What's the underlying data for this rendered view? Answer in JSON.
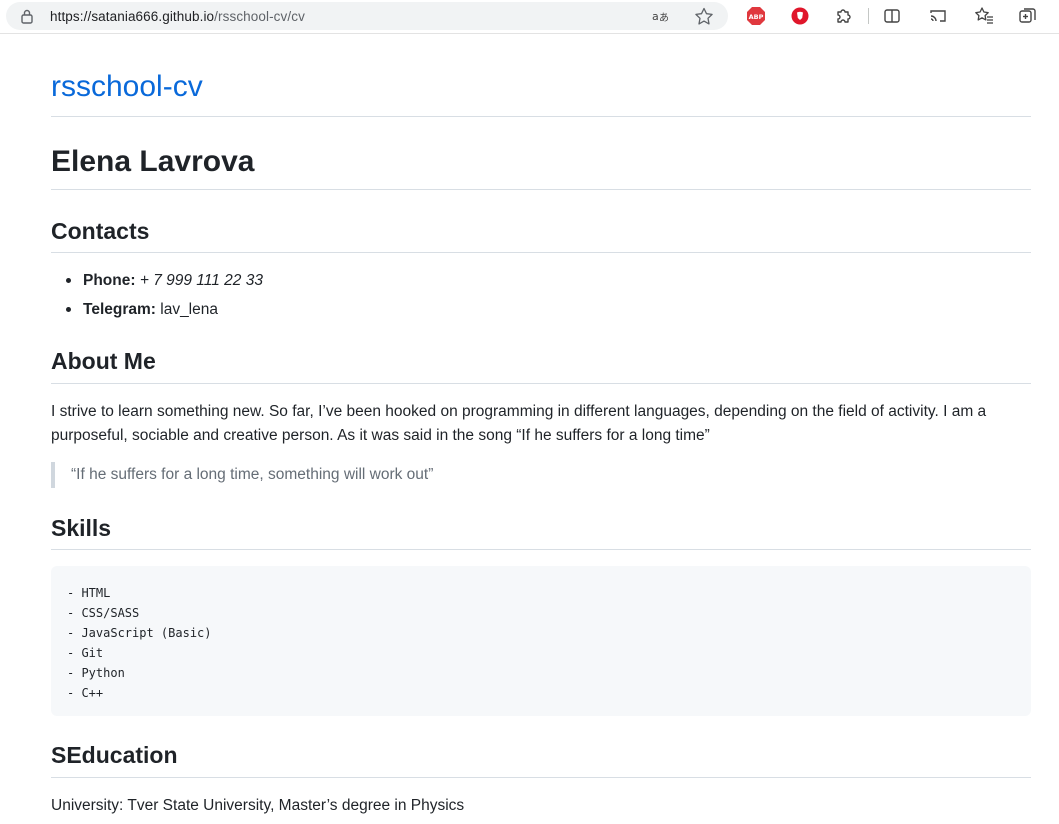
{
  "browser": {
    "url_host": "https://satania666.github.io",
    "url_path": "/rsschool-cv/cv",
    "icons": [
      "lock-icon",
      "translate-icon",
      "star-icon",
      "adblock-icon",
      "opera-icon",
      "extensions-icon",
      "split-screen-icon",
      "cast-icon",
      "favorites-icon",
      "collections-icon"
    ],
    "adblock_text": "ABP"
  },
  "page": {
    "site_title": "rsschool-cv",
    "name": "Elena Lavrova",
    "contacts": {
      "heading": "Contacts",
      "items": [
        {
          "label": "Phone:",
          "value": "+ 7 999 111 22 33"
        },
        {
          "label": "Telegram:",
          "value": "lav_lena"
        }
      ]
    },
    "about": {
      "heading": "About Me",
      "text": "I strive to learn something new. So far, I’ve been hooked on programming in different languages, depending on the field of activity. I am a purposeful, sociable and creative person. As it was said in the song “If he suffers for a long time”",
      "quote": "“If he suffers for a long time, something will work out”"
    },
    "skills": {
      "heading": "Skills",
      "items": [
        "- HTML",
        "- CSS/SASS",
        "- JavaScript (Basic)",
        "- Git",
        "- Python",
        "- C++"
      ]
    },
    "education": {
      "heading": "SEducation",
      "text": "University: Tver State University, Master’s degree in Physics"
    }
  },
  "colors": {
    "link": "#0969da",
    "text": "#1f2328",
    "muted": "#656d76",
    "rule": "#d8dee4",
    "code_bg": "#f6f8fa"
  }
}
